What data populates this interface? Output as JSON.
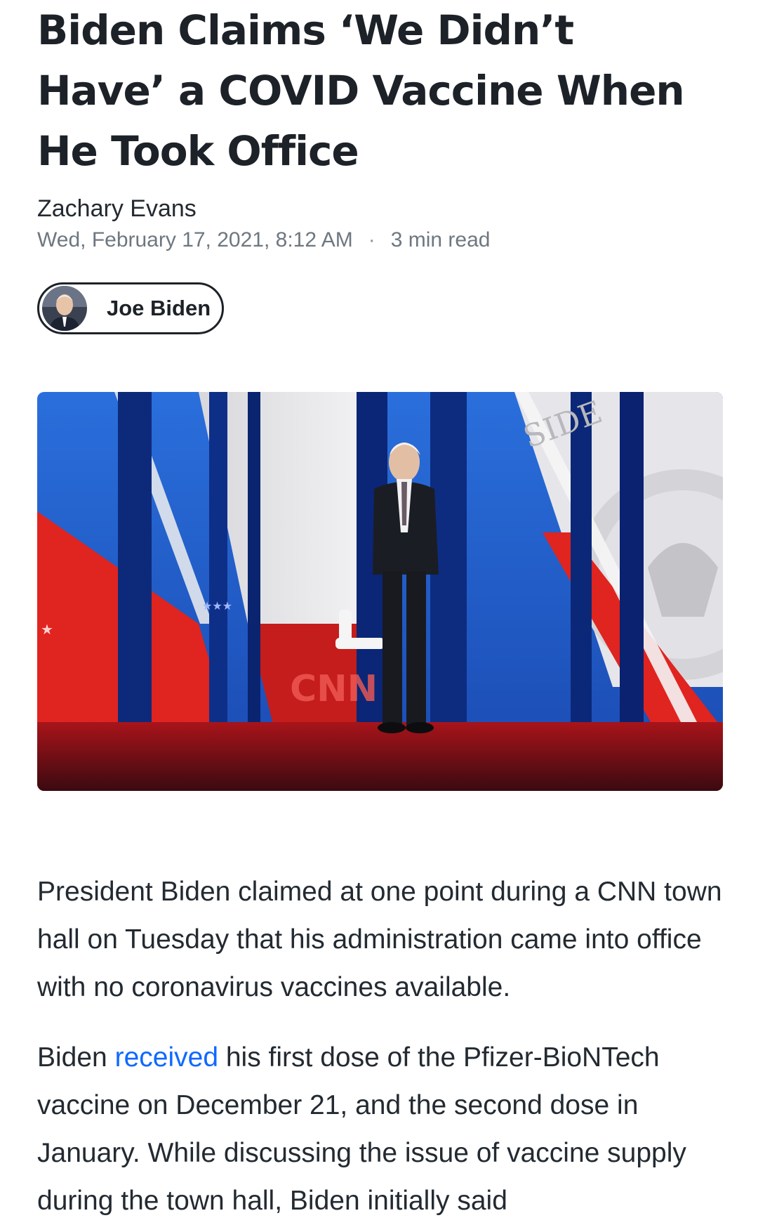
{
  "article": {
    "headline": "Biden Claims ‘We Didn’t Have’ a COVID Vaccine When He Took Office",
    "author": "Zachary Evans",
    "date": "Wed, February 17, 2021, 8:12 AM",
    "separator": "·",
    "read_time": "3 min read"
  },
  "topic_chip": {
    "label": "Joe Biden",
    "avatar_icon": "person-portrait-icon"
  },
  "hero_image": {
    "description_icon": "cnn-town-hall-photo",
    "logo_text": "CNN",
    "seal_text": "SIDE"
  },
  "body": {
    "paragraph_1": "President Biden claimed at one point during a CNN town hall on Tuesday that his administration came into office with no coronavirus vaccines available.",
    "paragraph_2_before": "Biden ",
    "paragraph_2_link": "received",
    "paragraph_2_after": " his first dose of the Pfizer-BioNTech vaccine on December 21, and the second dose in January. While discussing the issue of vaccine supply during the town hall, Biden initially said"
  },
  "colors": {
    "headline": "#1d2228",
    "meta": "#6e7780",
    "link": "#0f69ff",
    "stage_blue": "#1f5fd0",
    "stage_red": "#e0241f"
  }
}
